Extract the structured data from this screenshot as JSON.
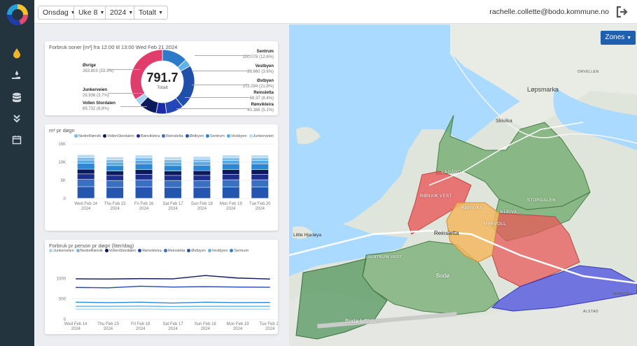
{
  "topbar": {
    "filters": [
      {
        "value": "Onsdag"
      },
      {
        "value": "Uke 8"
      },
      {
        "value": "2024"
      },
      {
        "value": "Totalt"
      }
    ],
    "user_email": "rachelle.collette@bodo.kommune.no"
  },
  "sidebar": {
    "items": [
      {
        "icon": "water-drop-icon"
      },
      {
        "icon": "hand-water-icon"
      },
      {
        "icon": "database-icon"
      },
      {
        "icon": "double-chevron-down-icon"
      },
      {
        "icon": "calendar-icon"
      }
    ]
  },
  "donut_card": {
    "title": "Forbruk soner [m³] fra 12:00 til  13:00 Wed Feb 21 2024",
    "center_value": "791.7",
    "center_label": "Totalt",
    "zones": [
      {
        "name": "Sentrum",
        "value": "100.078 (12.6%)",
        "color": "#2b7bc9"
      },
      {
        "name": "Vestbyen",
        "value": "28.660 (3.6%)",
        "color": "#5fb3e8"
      },
      {
        "name": "Østbyen",
        "value": "172.094 (21.8%)",
        "color": "#1f4fa8"
      },
      {
        "name": "Reinsletta",
        "value": "68.37 (8.4%)",
        "color": "#2346b8"
      },
      {
        "name": "Rønvikleira",
        "value": "40.386 (5.1%)",
        "color": "#1a2aa8"
      },
      {
        "name": "Vollen Stordalen",
        "value": "69.732 (8.8%)",
        "color": "#0b1a5c"
      },
      {
        "name": "Junkerveien",
        "value": "26.936 (3.7%)",
        "color": "#a9d3f2"
      },
      {
        "name": "Øvrige",
        "value": "263.803 (33.3%)",
        "color": "#e03c6c"
      }
    ]
  },
  "chart_data": [
    {
      "type": "bar",
      "title": "m³ pr døgn",
      "categories": [
        "Wed Feb 14 2024",
        "Thu Feb 15 2024",
        "Fri Feb 16 2024",
        "Sat Feb 17 2024",
        "Sun Feb 18 2024",
        "Mon Feb 19 2024",
        "Tue Feb 20 2024"
      ],
      "ylim": [
        0,
        15000
      ],
      "yticks": [
        "0",
        "5K",
        "10K",
        "15K"
      ],
      "legend": [
        "NedreRønvik",
        "VollenStordalen",
        "Rønvikleira",
        "Reinsletta",
        "Østbyen",
        "Sentrum",
        "Vestbyen",
        "Junkerveien"
      ],
      "series": [
        {
          "name": "Østbyen",
          "color": "#2456b0",
          "values": [
            3200,
            3000,
            3100,
            3000,
            3000,
            3100,
            3100
          ]
        },
        {
          "name": "Reinsletta",
          "color": "#3a6fc4",
          "values": [
            2000,
            1900,
            2000,
            1900,
            1900,
            2000,
            2000
          ]
        },
        {
          "name": "Rønvikleira",
          "color": "#1c2f8f",
          "values": [
            1500,
            1400,
            1500,
            1400,
            1400,
            1500,
            1500
          ]
        },
        {
          "name": "VollenStordalen",
          "color": "#0b1a5c",
          "values": [
            1300,
            1200,
            1300,
            1200,
            1300,
            1300,
            1300
          ]
        },
        {
          "name": "Sentrum",
          "color": "#2b86d6",
          "values": [
            1600,
            1500,
            1600,
            1500,
            1500,
            1600,
            1600
          ]
        },
        {
          "name": "Vestbyen",
          "color": "#5aa9e6",
          "values": [
            900,
            900,
            900,
            900,
            900,
            900,
            900
          ]
        },
        {
          "name": "NedreRønvik",
          "color": "#7ab8e8",
          "values": [
            700,
            700,
            700,
            700,
            700,
            700,
            700
          ]
        },
        {
          "name": "Junkerveien",
          "color": "#b9dcf5",
          "values": [
            800,
            800,
            800,
            800,
            800,
            800,
            800
          ]
        }
      ]
    },
    {
      "type": "line",
      "title": "Forbruk pr person pr døgn (liter/dag)",
      "categories": [
        "Wed Feb 14 2024",
        "Thu Feb 15 2024",
        "Fri Feb 16 2024",
        "Sat Feb 17 2024",
        "Sun Feb 18 2024",
        "Mon Feb 19 2024",
        "Tue Feb 20 2024"
      ],
      "ylim": [
        0,
        1500
      ],
      "yticks": [
        "0",
        "500",
        "1000"
      ],
      "legend": [
        "Junkerveien",
        "NedreRønvik",
        "VollenStordalen",
        "Rønvikleira",
        "Reinsletta",
        "Østbyen",
        "Vestbyen",
        "Sentrum"
      ],
      "series": [
        {
          "name": "VollenStordalen",
          "color": "#0b1a5c",
          "values": [
            990,
            985,
            995,
            990,
            1070,
            1010,
            985
          ]
        },
        {
          "name": "Rønvikleira",
          "color": "#2346b8",
          "values": [
            780,
            770,
            810,
            790,
            800,
            790,
            785
          ]
        },
        {
          "name": "Sentrum",
          "color": "#2b86d6",
          "values": [
            420,
            410,
            420,
            400,
            420,
            410,
            415
          ]
        },
        {
          "name": "Vestbyen",
          "color": "#5fb3e8",
          "values": [
            320,
            320,
            325,
            315,
            320,
            320,
            320
          ]
        },
        {
          "name": "Junkerveien",
          "color": "#a9d3f2",
          "values": [
            250,
            250,
            255,
            245,
            255,
            250,
            250
          ]
        }
      ]
    }
  ],
  "map": {
    "zones_button": "Zones",
    "labels": [
      "Løpsmarka",
      "Skivika",
      "LAGÅRD",
      "STORDALEN",
      "RØNVIK VEST",
      "RØNVIKA",
      "KLEIVA",
      "MYRVOLL",
      "Reinsletta",
      "SENTRUM VEST",
      "Bodø",
      "Bodø lufthavn",
      "Little Hjartøya",
      "ALSTAD",
      "JENSVOLL",
      "ORVELLEN"
    ]
  }
}
